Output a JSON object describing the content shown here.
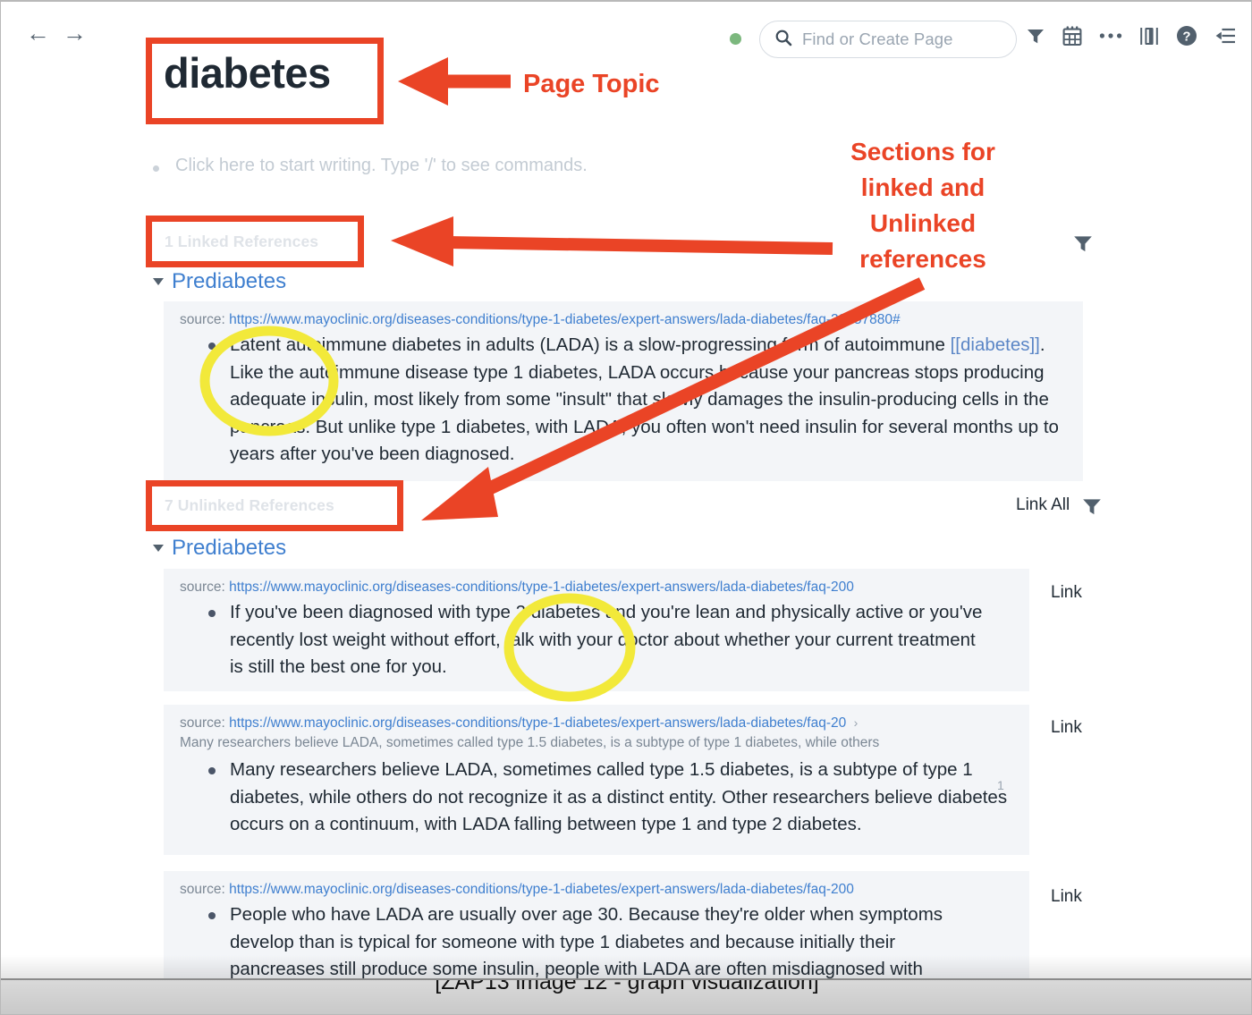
{
  "app": {
    "window_title": "",
    "caption": "[ZAP13 image 12 - graph visualization]"
  },
  "topbar": {
    "back_icon": "←",
    "forward_icon": "→",
    "status_dot_color": "#7cb87e",
    "search": {
      "placeholder": "Find or Create Page",
      "value": ""
    },
    "icons": [
      {
        "name": "filter-icon",
        "label": "Filter"
      },
      {
        "name": "calendar-icon",
        "label": "Daily Notes"
      },
      {
        "name": "ellipsis-icon",
        "label": "More options"
      },
      {
        "name": "sidebar-split-icon",
        "label": "Toggle right sidebar"
      },
      {
        "name": "help-icon",
        "label": "Help"
      },
      {
        "name": "collapse-right-icon",
        "label": "Open right sidebar"
      }
    ]
  },
  "page": {
    "title": "diabetes",
    "placeholder_block": "Click here to start writing. Type '/' to see commands."
  },
  "linked_section": {
    "header": "1 Linked References",
    "filter_icon": "filter-icon",
    "groups": [
      {
        "title": "Prediabetes",
        "collapsed": false,
        "cards": [
          {
            "source_label": "source:",
            "source_url": "https://www.mayoclinic.org/diseases-conditions/type-1-diabetes/expert-answers/lada-diabetes/faq-20057880#",
            "body_pre": "Latent autoimmune diabetes in adults (LADA) is a slow-progressing form of autoimmune ",
            "body_tag": "[[diabetes]]",
            "body_post": ". Like the autoimmune disease type 1 diabetes, LADA occurs because your pancreas stops producing adequate insulin, most likely from some \"insult\" that slowly damages the insulin-producing cells in the pancreas. But unlike type 1 diabetes, with LADA, you often won't need insulin for several months up to years after you've been diagnosed."
          }
        ]
      }
    ]
  },
  "unlinked_section": {
    "header": "7 Unlinked References",
    "link_all_label": "Link All",
    "filter_icon": "filter-icon",
    "groups": [
      {
        "title": "Prediabetes",
        "collapsed": false,
        "cards": [
          {
            "source_label": "source:",
            "source_url": "https://www.mayoclinic.org/diseases-conditions/type-1-diabetes/expert-answers/lada-diabetes/faq-200",
            "chevron": "",
            "sub_note": "",
            "body": "If you've been diagnosed with type 2 diabetes and you're lean and physically active or you've recently lost weight without effort, talk with your doctor about whether your current treatment is still the best one for you.",
            "link_label": "Link",
            "count": ""
          },
          {
            "source_label": "source:",
            "source_url": "https://www.mayoclinic.org/diseases-conditions/type-1-diabetes/expert-answers/lada-diabetes/faq-20",
            "chevron": "›",
            "sub_note": "Many researchers believe LADA, sometimes called type 1.5 diabetes, is a subtype of type 1 diabetes, while others",
            "body": "Many researchers believe LADA, sometimes called type 1.5 diabetes, is a subtype of type 1 diabetes, while others do not recognize it as a distinct entity. Other researchers believe diabetes occurs on a continuum, with LADA falling between type 1 and type 2 diabetes.",
            "link_label": "Link",
            "count": "1"
          },
          {
            "source_label": "source:",
            "source_url": "https://www.mayoclinic.org/diseases-conditions/type-1-diabetes/expert-answers/lada-diabetes/faq-200",
            "chevron": "",
            "sub_note": "",
            "body": "People who have LADA are usually over age 30. Because they're older when symptoms develop than is typical for someone with type 1 diabetes and because initially their pancreases still produce some insulin, people with LADA are often misdiagnosed with",
            "link_label": "Link",
            "count": ""
          }
        ]
      }
    ]
  },
  "annotations": {
    "color": "#ea4426",
    "highlight_color": "#f2e93a",
    "labels": {
      "page_topic": "Page Topic",
      "sections": "Sections for linked and Unlinked references"
    },
    "boxes": [
      "page-title",
      "linked-references-header",
      "unlinked-references-header"
    ],
    "ellipses": [
      "diabetes-tag-highlight",
      "type-2-diabetes-highlight"
    ]
  }
}
